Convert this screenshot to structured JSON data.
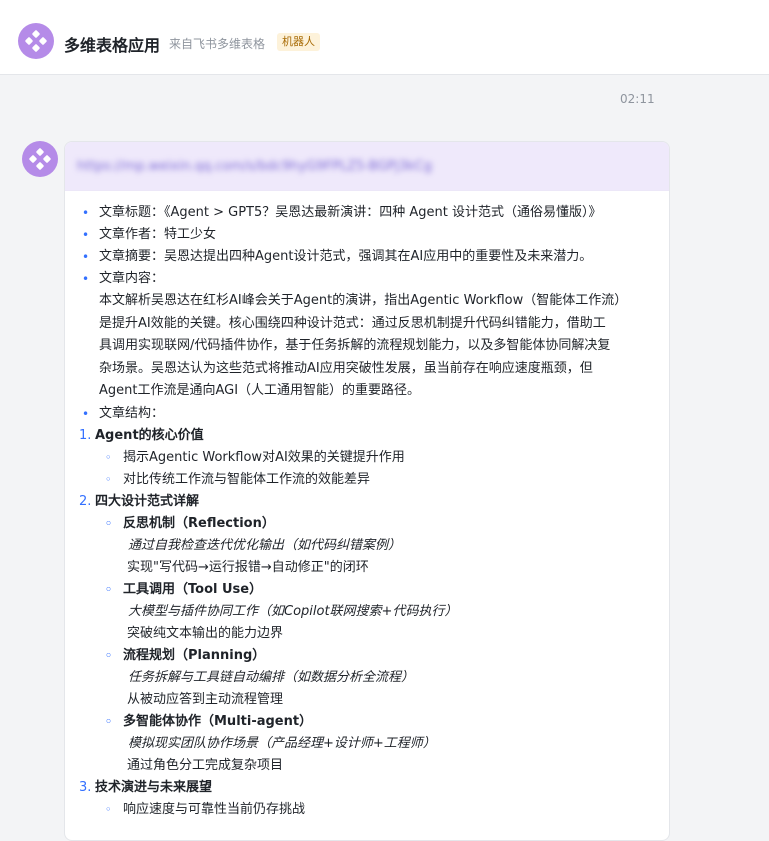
{
  "header": {
    "title": "多维表格应用",
    "subtitle": "来自飞书多维表格",
    "badge": "机器人"
  },
  "message": {
    "timestamp": "02:11",
    "link": "https://mp.weixin.qq.com/s/bdc9hyG9FPLZ5-BGPj3kCg",
    "bullets": [
      "文章标题：《Agent > GPT5？吴恩达最新演讲：四种 Agent 设计范式（通俗易懂版）》",
      "文章作者：特工少女",
      "文章摘要：吴恩达提出四种Agent设计范式，强调其在AI应用中的重要性及未来潜力。",
      "文章内容："
    ],
    "content_lines": [
      "本文解析吴恩达在红杉AI峰会关于Agent的演讲，指出Agentic Workflow（智能体工作流）",
      "是提升AI效能的关键。核心围绕四种设计范式：通过反思机制提升代码纠错能力，借助工",
      "具调用实现联网/代码插件协作，基于任务拆解的流程规划能力，以及多智能体协同解决复",
      "杂场景。吴恩达认为这些范式将推动AI应用突破性发展，虽当前存在响应速度瓶颈，但",
      "Agent工作流是通向AGI（人工通用智能）的重要路径。"
    ],
    "structure_label": "文章结构：",
    "sections": [
      {
        "num": "1.",
        "title": "Agent的核心价值",
        "items": [
          "揭示Agentic Workflow对AI效果的关键提升作用",
          "对比传统工作流与智能体工作流的效能差异"
        ]
      },
      {
        "num": "2.",
        "title": "四大设计范式详解",
        "patterns": [
          {
            "name": "反思机制（Reflection）",
            "example": "通过自我检查迭代优化输出（如代码纠错案例）",
            "desc": "实现\"写代码→运行报错→自动修正\"的闭环"
          },
          {
            "name": "工具调用（Tool Use）",
            "example": "大模型与插件协同工作（如Copilot联网搜索+代码执行）",
            "desc": "突破纯文本输出的能力边界"
          },
          {
            "name": "流程规划（Planning）",
            "example": "任务拆解与工具链自动编排（如数据分析全流程）",
            "desc": "从被动应答到主动流程管理"
          },
          {
            "name": "多智能体协作（Multi-agent）",
            "example": "模拟现实团队协作场景（产品经理+设计师+工程师）",
            "desc": "通过角色分工完成复杂项目"
          }
        ]
      },
      {
        "num": "3.",
        "title": "技术演进与未来展望",
        "items": [
          "响应速度与可靠性当前仍存挑战"
        ]
      }
    ]
  },
  "colors": {
    "accent": "#3370ff",
    "avatar": "#b58be8",
    "badge_bg": "#fdf2da",
    "badge_text": "#a86b06"
  }
}
